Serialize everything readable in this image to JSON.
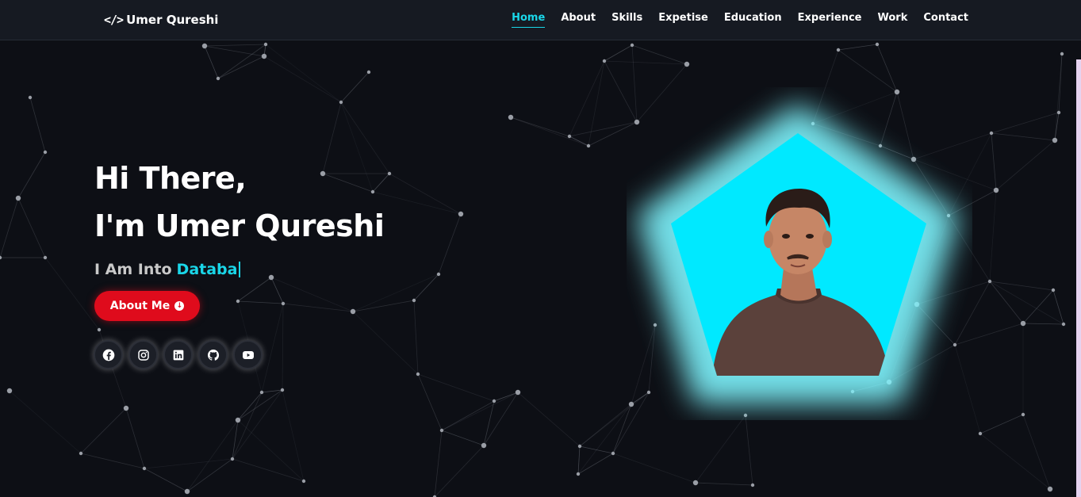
{
  "brand": {
    "icon": "</>",
    "name": "Umer Qureshi"
  },
  "nav": {
    "items": [
      {
        "label": "Home",
        "active": true
      },
      {
        "label": "About",
        "active": false
      },
      {
        "label": "Skills",
        "active": false
      },
      {
        "label": "Expetise",
        "active": false
      },
      {
        "label": "Education",
        "active": false
      },
      {
        "label": "Experience",
        "active": false
      },
      {
        "label": "Work",
        "active": false
      },
      {
        "label": "Contact",
        "active": false
      }
    ]
  },
  "hero": {
    "greeting_line1": "Hi There,",
    "greeting_line2": "I'm Umer Qureshi",
    "typing_prefix": "I Am Into",
    "typing_text": "Databa",
    "button_label": "About Me",
    "button_icon": "arrow-circle-down-icon"
  },
  "socials": [
    {
      "name": "facebook-icon"
    },
    {
      "name": "instagram-icon"
    },
    {
      "name": "linkedin-icon"
    },
    {
      "name": "github-icon"
    },
    {
      "name": "youtube-icon"
    }
  ],
  "colors": {
    "background": "#0d0f15",
    "navbar": "#161a22",
    "accent": "#1ad6e8",
    "button": "#df0b1c",
    "pentagon": "#00e9ff"
  }
}
